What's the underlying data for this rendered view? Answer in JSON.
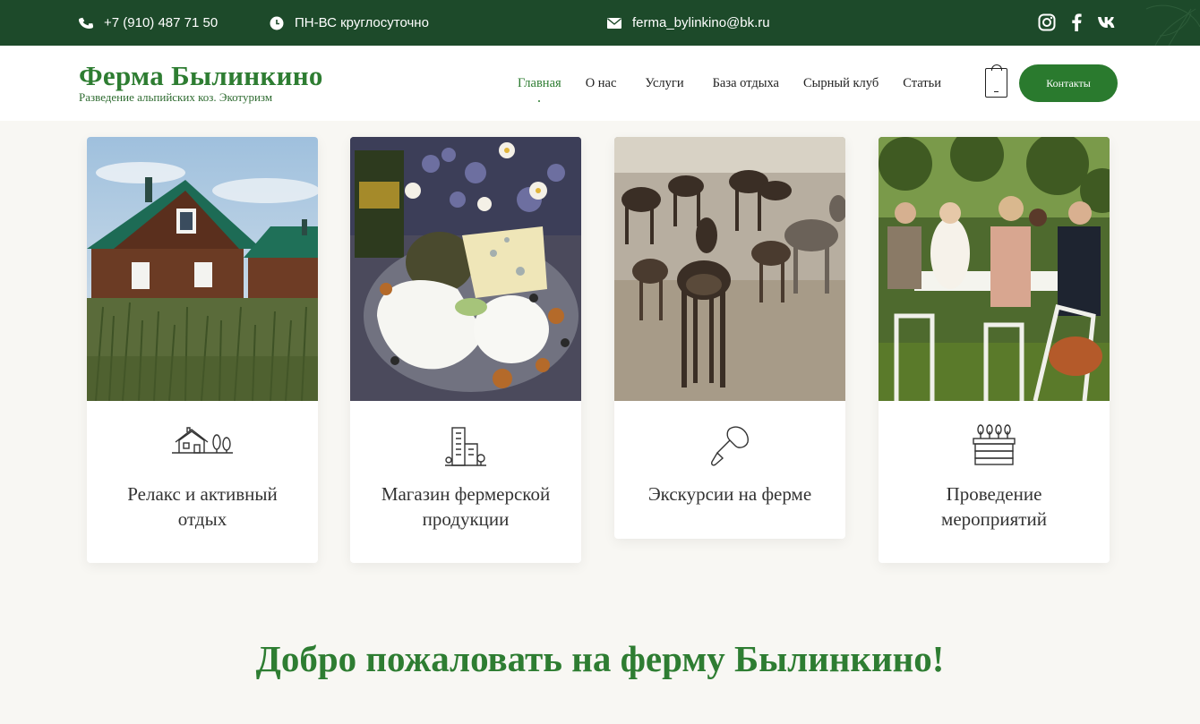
{
  "topbar": {
    "phone": "+7 (910) 487 71 50",
    "hours": "ПН-ВС круглосуточно",
    "email": "ferma_bylinkino@bk.ru",
    "social": [
      "instagram-icon",
      "facebook-icon",
      "vk-icon"
    ]
  },
  "header": {
    "logo_title": "Ферма Былинкино",
    "logo_subtitle": "Разведение альпийских коз. Экотуризм",
    "nav": [
      "Главная",
      "О нас",
      "Услуги",
      "База отдыха",
      "Сырный клуб",
      "Статьи"
    ],
    "active_nav": "Главная",
    "contact_button": "Контакты"
  },
  "cards": [
    {
      "title": "Релакс и активный отдых",
      "icon": "house-trees-icon"
    },
    {
      "title": "Магазин фермерской продукции",
      "icon": "shop-building-icon"
    },
    {
      "title": "Экскурсии на ферме",
      "icon": "trowel-icon"
    },
    {
      "title": "Проведение мероприятий",
      "icon": "planter-icon"
    }
  ],
  "welcome": "Добро пожаловать на ферму Былинкино!",
  "colors": {
    "brand_green": "#2e7d32",
    "topbar": "#1d4a2a",
    "button": "#2a7a2e",
    "background": "#f8f7f3"
  }
}
